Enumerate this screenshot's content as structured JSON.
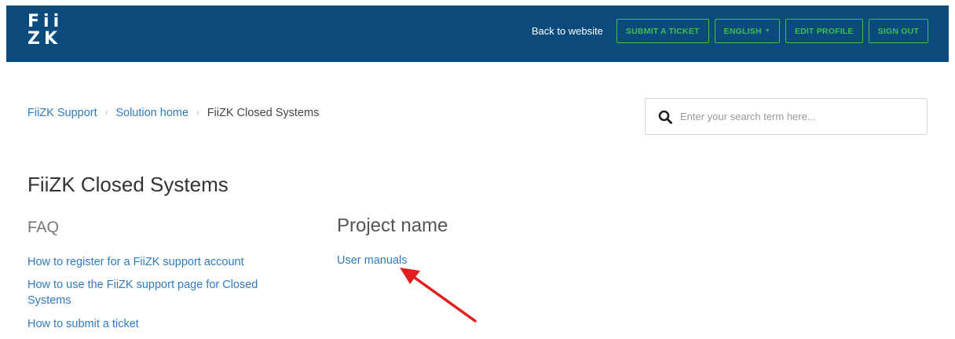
{
  "header": {
    "logo_line1": "Fii",
    "logo_line2": "ZK",
    "back_link": "Back to website",
    "buttons": {
      "submit_ticket": "SUBMIT A TICKET",
      "language": "ENGLISH",
      "edit_profile": "EDIT PROFILE",
      "sign_out": "SIGN OUT"
    },
    "colors": {
      "bar": "#0a4a7c",
      "button_accent": "#3fbf4b"
    }
  },
  "breadcrumb": {
    "items": [
      "FiiZK Support",
      "Solution home",
      "FiiZK Closed Systems"
    ]
  },
  "search": {
    "placeholder": "Enter your search term here...",
    "icon": "search-icon"
  },
  "main": {
    "title": "FiiZK Closed Systems",
    "sections": [
      {
        "heading": "FAQ",
        "articles": [
          "How to register for a FiiZK support account",
          "How to use the FiiZK support page for Closed Systems",
          "How to submit a ticket"
        ]
      },
      {
        "heading": "Project name",
        "articles": [
          "User manuals"
        ]
      }
    ]
  },
  "annotation": {
    "icon": "arrow-annotation-icon",
    "color": "#e21e1e"
  }
}
